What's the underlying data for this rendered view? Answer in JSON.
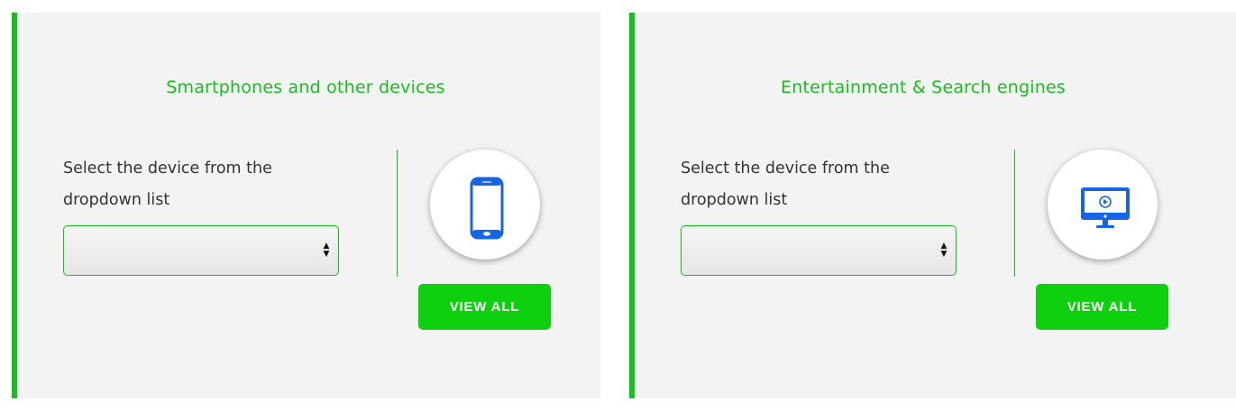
{
  "cards": [
    {
      "title": "Smartphones and other devices",
      "description": "Select the device from the dropdown list",
      "select_value": "",
      "icon": "smartphone-icon",
      "button_label": "VIEW ALL"
    },
    {
      "title": "Entertainment & Search engines",
      "description": "Select the device from the dropdown list",
      "select_value": "",
      "icon": "monitor-play-icon",
      "button_label": "VIEW ALL"
    }
  ],
  "colors": {
    "accent": "#12c21a",
    "button": "#0ed00e",
    "icon": "#1565e6",
    "card_bg": "#f3f3f3"
  }
}
